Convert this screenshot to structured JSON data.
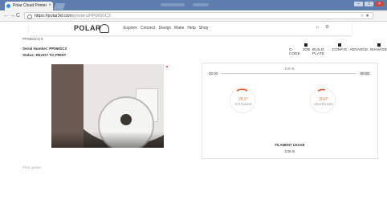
{
  "browser": {
    "tab_title": "Polar Cloud Printer",
    "url_host": "https://polar3d.com",
    "url_path": "/printers/PP0691C3",
    "nav": {
      "back": "←",
      "forward": "→",
      "reload": "C"
    },
    "omni_icons": "☆ ★",
    "window_buttons": [
      "–",
      "□",
      "×"
    ]
  },
  "site": {
    "logo": "POLAR",
    "menu": [
      "Explore",
      "Connect",
      "Design",
      "Make",
      "Help",
      "Shop"
    ],
    "header_icons": [
      "♫",
      "⚙"
    ]
  },
  "printer": {
    "selector": "PP0691C3 ▾",
    "serial_label": "Serial Number: PP0691C3",
    "status_label": "Status: READY TO PRINT"
  },
  "actions": [
    "G-CODE",
    "JOB",
    "BUILD PLATE",
    "CONFIG",
    "ADVANCE",
    "MANAGE"
  ],
  "progress": {
    "elapsed": "00:00",
    "remaining": "00:00",
    "percent_text": "0.0 %",
    "percent": 0
  },
  "extruder": {
    "temp": "28.0°",
    "label": "EXTRUDER"
  },
  "bed": {
    "temp": "30.0°",
    "label": "HEATED BED"
  },
  "filament": {
    "title": "FILAMENT USAGE",
    "value": "0.00 m"
  },
  "queue": {
    "label": "Print queue"
  },
  "colors": {
    "accent": "#e05a2b",
    "titlebar": "#5c7dae"
  }
}
